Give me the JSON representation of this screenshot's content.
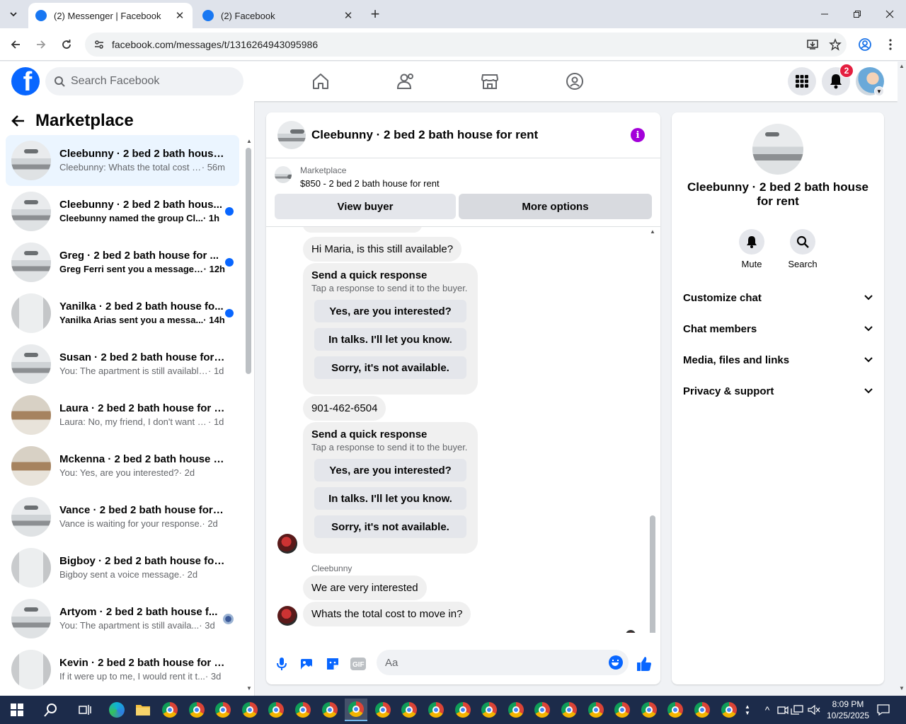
{
  "browser": {
    "tabs": [
      {
        "title": "(2) Messenger | Facebook",
        "active": true
      },
      {
        "title": "(2) Facebook",
        "active": false
      }
    ],
    "url": "facebook.com/messages/t/1316264943095986"
  },
  "header": {
    "search_placeholder": "Search Facebook",
    "notification_count": "2"
  },
  "left": {
    "title": "Marketplace",
    "conversations": [
      {
        "name": "Cleebunny · 2 bed 2 bath house ...",
        "preview": "Cleebunny: Whats the total cost t...",
        "time": " · 56m",
        "status": "active",
        "thumb": "bed"
      },
      {
        "name": "Cleebunny · 2 bed 2 bath hous...",
        "preview": "Cleebunny named the group Cl...",
        "time": " · 1h",
        "status": "unread",
        "thumb": "bed"
      },
      {
        "name": "Greg · 2 bed 2 bath house for ...",
        "preview": "Greg Ferri sent you a message ...",
        "time": " · 12h",
        "status": "unread",
        "thumb": "bed"
      },
      {
        "name": "Yanilka · 2 bed 2 bath house fo...",
        "preview": "Yanilka Arias sent you a messa...",
        "time": " · 14h",
        "status": "unread",
        "thumb": "hall"
      },
      {
        "name": "Susan · 2 bed 2 bath house for r...",
        "preview": "You: The apartment is still available ...",
        "time": " · 1d",
        "status": "read",
        "thumb": "bed"
      },
      {
        "name": "Laura · 2 bed 2 bath house for r...",
        "preview": "Laura: No, my friend, I don't want a...",
        "time": " · 1d",
        "status": "read",
        "thumb": "living"
      },
      {
        "name": "Mckenna · 2 bed 2 bath house f...",
        "preview": "You: Yes, are you interested?",
        "time": " · 2d",
        "status": "read",
        "thumb": "living"
      },
      {
        "name": "Vance · 2 bed 2 bath house for r...",
        "preview": "Vance is waiting for your response.",
        "time": " · 2d",
        "status": "read",
        "thumb": "bed"
      },
      {
        "name": "Bigboy · 2 bed 2 bath house for ...",
        "preview": "Bigboy sent a voice message.",
        "time": " · 2d",
        "status": "read",
        "thumb": "hall"
      },
      {
        "name": "Artyom · 2 bed 2 bath house f...",
        "preview": "You: The apartment is still availa...",
        "time": " · 3d",
        "status": "seen",
        "thumb": "bed"
      },
      {
        "name": "Kevin · 2 bed 2 bath house for r...",
        "preview": "If it were up to me, I would rent it t...",
        "time": " · 3d",
        "status": "read",
        "thumb": "hall"
      }
    ]
  },
  "chat": {
    "title": "Cleebunny · 2 bed 2 bath house for rent",
    "marketplace_label": "Marketplace",
    "listing": "$850 - 2 bed 2 bath house for rent",
    "view_buyer": "View buyer",
    "more_options": "More options",
    "messages": {
      "m1": "Hi Maria, is this still available?",
      "qr_title": "Send a quick response",
      "qr_sub": "Tap a response to send it to the buyer.",
      "qr_options": [
        "Yes, are you interested?",
        "In talks. I'll let you know.",
        "Sorry, it's not available."
      ],
      "phone": "901-462-6504",
      "sender": "Cleebunny",
      "m2": "We are very interested",
      "m3": "Whats the total cost to move in?"
    },
    "composer_placeholder": "Aa"
  },
  "details": {
    "title": "Cleebunny · 2 bed 2 bath house for rent",
    "mute": "Mute",
    "search": "Search",
    "sections": [
      "Customize chat",
      "Chat members",
      "Media, files and links",
      "Privacy & support"
    ]
  },
  "taskbar": {
    "time": "8:09 PM",
    "date": "10/25/2025"
  },
  "colors": {
    "fb_blue": "#0866ff",
    "unread_dot": "#0866ff",
    "info_purple": "#a300d9",
    "badge_red": "#e41e3f"
  }
}
